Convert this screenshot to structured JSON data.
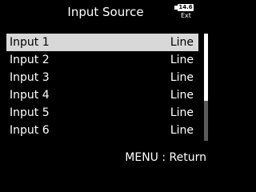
{
  "header": {
    "title": "Input Source",
    "battery": {
      "level_label": "14.6",
      "source_label": "Ext"
    }
  },
  "inputs": [
    {
      "name": "Input 1",
      "value": "Line",
      "selected": true
    },
    {
      "name": "Input 2",
      "value": "Line",
      "selected": false
    },
    {
      "name": "Input 3",
      "value": "Line",
      "selected": false
    },
    {
      "name": "Input 4",
      "value": "Line",
      "selected": false
    },
    {
      "name": "Input 5",
      "value": "Line",
      "selected": false
    },
    {
      "name": "Input 6",
      "value": "Line",
      "selected": false
    }
  ],
  "footer": {
    "hint": "MENU : Return"
  },
  "colors": {
    "background": "#000000",
    "text": "#ffffff",
    "highlight": "#d8d8d8",
    "scroll_track": "#5c5c5c"
  }
}
